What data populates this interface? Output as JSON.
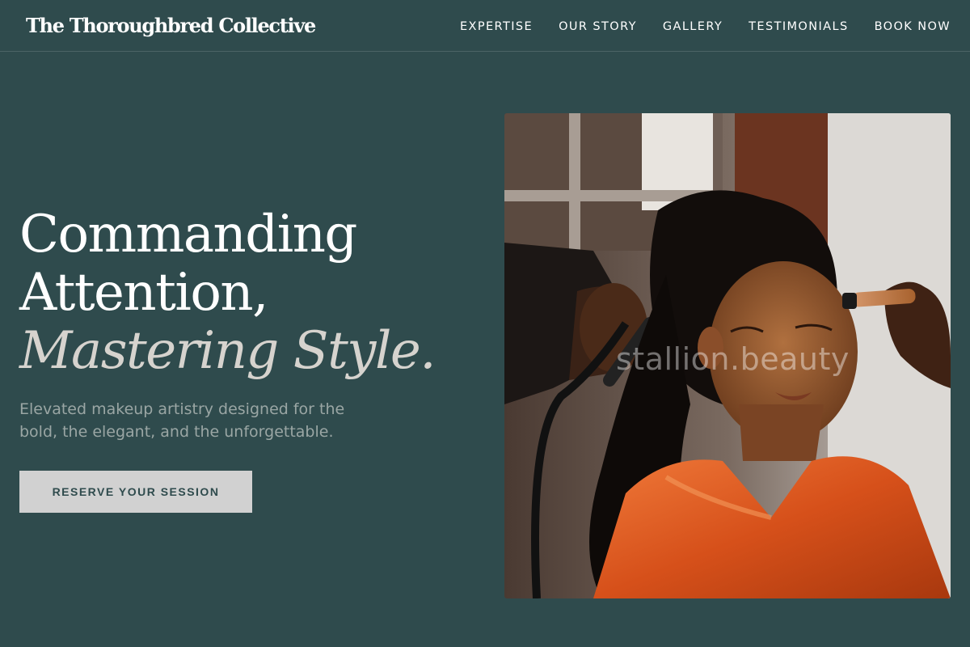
{
  "header": {
    "brand": "The Thoroughbred Collective",
    "nav": [
      {
        "label": "EXPERTISE"
      },
      {
        "label": "OUR STORY"
      },
      {
        "label": "GALLERY"
      },
      {
        "label": "TESTIMONIALS"
      },
      {
        "label": "BOOK NOW"
      }
    ]
  },
  "hero": {
    "headline_line1": "Commanding",
    "headline_line2": "Attention,",
    "headline_accent": "Mastering Style.",
    "subtitle": "Elevated makeup artistry designed for the bold, the elegant, and the unforgettable.",
    "cta_label": "RESERVE YOUR SESSION"
  },
  "image": {
    "watermark": "stallion.beauty"
  },
  "colors": {
    "background": "#2f4b4d",
    "cta_background": "#d1d1d1",
    "cta_text": "#2f4b4d",
    "robe": "#d6501a"
  }
}
